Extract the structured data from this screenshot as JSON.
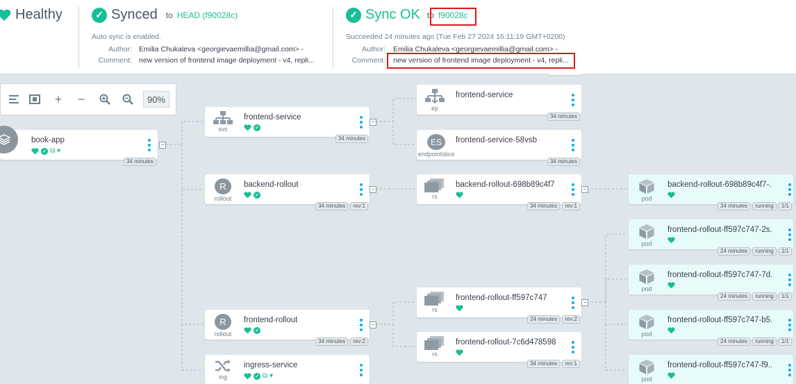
{
  "header": {
    "health": {
      "label": "Healthy"
    },
    "sync": {
      "label": "Synced",
      "to_prefix": "to",
      "target": "HEAD (f90028c)",
      "auto_sync": "Auto sync is enabled.",
      "author_label": "Author:",
      "author": "Emilia Chukaleva <georgievaemillia@gmail.com> -",
      "comment_label": "Comment:",
      "comment": "new version of frontend image deployment - v4, repli..."
    },
    "operation": {
      "label": "Sync OK",
      "to_prefix": "to",
      "revision": "f90028c",
      "succeeded": "Succeeded 24 minutes ago (Tue Feb 27 2024 16:11:19 GMT+0200)",
      "author_label": "Author:",
      "author": "Emilia Chukaleva <georgievaemillia@gmail.com> -",
      "comment_label": "Comment:",
      "comment": "new version of frontend image deployment - v4, repli..."
    }
  },
  "toolbar": {
    "zoom": "90%"
  },
  "nodes": [
    {
      "name": "book-app",
      "kind": "",
      "tags": [
        "34 minutes"
      ]
    },
    {
      "name": "frontend-service",
      "kind": "svc",
      "tags": [
        "34 minutes"
      ]
    },
    {
      "name": "backend-rollout",
      "kind": "rollout",
      "tags": [
        "34 minutes",
        "rev:1"
      ]
    },
    {
      "name": "frontend-rollout",
      "kind": "rollout",
      "tags": [
        "34 minutes",
        "rev:2"
      ]
    },
    {
      "name": "ingress-service",
      "kind": "ing",
      "tags": []
    },
    {
      "name": "frontend-service",
      "kind": "ep",
      "tags": [
        "34 minutes"
      ]
    },
    {
      "name": "frontend-service-58vsb",
      "kind": "endpointslice",
      "tags": [
        "34 minutes"
      ]
    },
    {
      "name": "backend-rollout-698b89c4f7",
      "kind": "rs",
      "tags": [
        "34 minutes",
        "rev:1"
      ]
    },
    {
      "name": "frontend-rollout-ff597c747",
      "kind": "rs",
      "tags": [
        "24 minutes",
        "rev:2"
      ]
    },
    {
      "name": "frontend-rollout-7c6d478598",
      "kind": "rs",
      "tags": [
        "34 minutes",
        "rev:1"
      ]
    },
    {
      "name": "backend-rollout-698b89c4f7-...",
      "kind": "pod",
      "tags": [
        "34 minutes",
        "running",
        "1/1"
      ]
    },
    {
      "name": "frontend-rollout-ff597c747-2s...",
      "kind": "pod",
      "tags": [
        "24 minutes",
        "running",
        "1/1"
      ]
    },
    {
      "name": "frontend-rollout-ff597c747-7d...",
      "kind": "pod",
      "tags": [
        "24 minutes",
        "running",
        "1/1"
      ]
    },
    {
      "name": "frontend-rollout-ff597c747-b5...",
      "kind": "pod",
      "tags": [
        "24 minutes",
        "running",
        "1/1"
      ]
    },
    {
      "name": "frontend-rollout-ff597c747-f9...",
      "kind": "pod",
      "tags": []
    }
  ],
  "icons": {
    "es": "ES",
    "r": "R"
  },
  "colors": {
    "green": "#18be94",
    "red": "#e0161b",
    "link": "#0dadea"
  }
}
